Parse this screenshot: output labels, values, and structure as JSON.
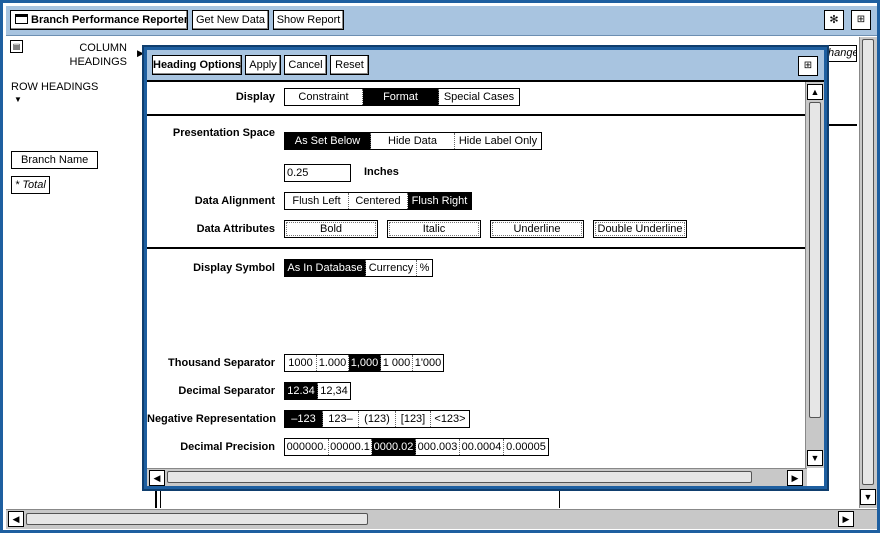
{
  "toolbar": {
    "app_title": "Branch Performance Reporter",
    "get_new_data": "Get New Data",
    "show_report": "Show Report"
  },
  "background": {
    "column_headings": "COLUMN HEADINGS",
    "row_headings": "ROW HEADINGS",
    "branch_name": "Branch Name",
    "total": "* Total",
    "change_partial": "hange"
  },
  "dialog": {
    "title": "Heading Options",
    "apply": "Apply",
    "cancel": "Cancel",
    "reset": "Reset",
    "display": {
      "label": "Display",
      "options": [
        "Constraint",
        "Format",
        "Special Cases"
      ],
      "selected": "Format"
    },
    "presentation_space": {
      "label": "Presentation Space",
      "options": [
        "As Set Below",
        "Hide Data",
        "Hide Label Only"
      ],
      "selected": "As Set Below"
    },
    "width": {
      "value": "0.25",
      "unit": "Inches"
    },
    "data_alignment": {
      "label": "Data Alignment",
      "options": [
        "Flush Left",
        "Centered",
        "Flush Right"
      ],
      "selected": "Flush Right"
    },
    "data_attributes": {
      "label": "Data Attributes",
      "options": [
        "Bold",
        "Italic",
        "Underline",
        "Double Underline"
      ]
    },
    "display_symbol": {
      "label": "Display Symbol",
      "options": [
        "As In Database",
        "Currency",
        "%"
      ],
      "selected": "As In Database"
    },
    "thousand_separator": {
      "label": "Thousand Separator",
      "options": [
        "1000",
        "1.000",
        "1,000",
        "1 000",
        "1'000"
      ],
      "selected": "1,000"
    },
    "decimal_separator": {
      "label": "Decimal Separator",
      "options": [
        "12.34",
        "12,34"
      ],
      "selected": "12.34"
    },
    "negative_representation": {
      "label": "Negative Representation",
      "options": [
        "–123",
        "123–",
        "(123)",
        "[123]",
        "<123>"
      ],
      "selected": "–123"
    },
    "decimal_precision": {
      "label": "Decimal Precision",
      "options": [
        "000000.",
        "00000.1",
        "0000.02",
        "000.003",
        "00.0004",
        "0.00005"
      ],
      "selected": "0000.02"
    }
  }
}
